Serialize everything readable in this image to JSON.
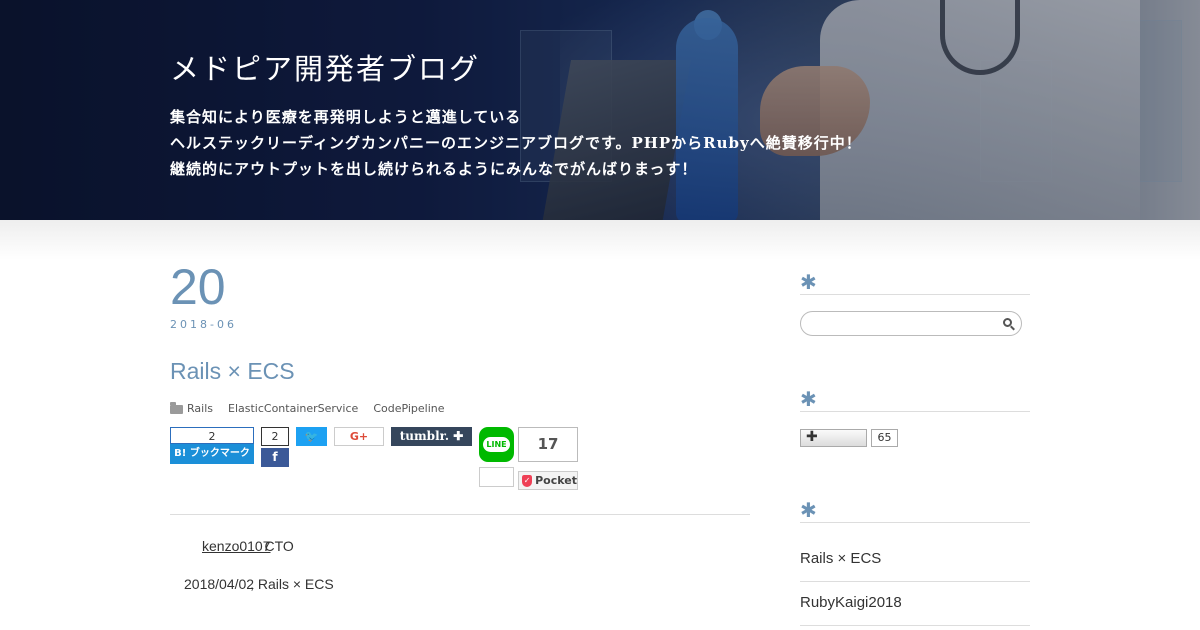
{
  "header": {
    "site_title": "メドピア開発者ブログ",
    "tagline": [
      "集合知により医療を再発明しようと邁進している",
      "ヘルステックリーディングカンパニーのエンジニアブログです。PHPからRubyへ絶賛移行中！",
      "継続的にアウトプットを出し続けられるようにみんなでがんばりまっす！"
    ]
  },
  "post": {
    "day": "20",
    "year_month": "2018-06",
    "title": "Rails × ECS",
    "categories": [
      "Rails",
      "ElasticContainerService",
      "CodePipeline"
    ],
    "author": "kenzo0107",
    "author_role": "CTO",
    "body_date": "2018/04/02",
    "body_text": "Rails × ECS"
  },
  "share": {
    "hatena_count": "2",
    "hatena_label": "B! ブックマーク",
    "facebook_count": "2",
    "facebook_label": "f",
    "twitter_label": "🐦",
    "gplus_label": "G+",
    "tumblr_label": "tumblr. ✚",
    "line_label": "LINE",
    "pocket_count": "17",
    "pocket_label": "Pocket"
  },
  "sidebar": {
    "widget_glyph": "✱",
    "search_placeholder": "",
    "follow_label": "✚",
    "follow_count": "65",
    "recent_posts": [
      "Rails × ECS",
      "RubyKaigi2018"
    ]
  },
  "colors": {
    "accent": "#6b92b5",
    "hatena": "#1b8fd8",
    "facebook": "#3b5998",
    "twitter": "#1da1f2",
    "tumblr": "#35465c",
    "line": "#00b900",
    "pocket": "#ef4056"
  }
}
